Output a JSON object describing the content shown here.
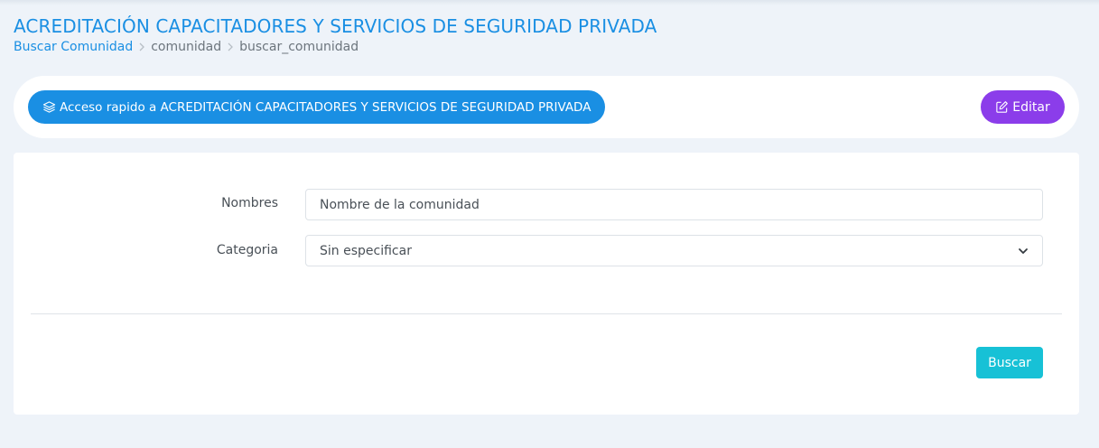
{
  "page": {
    "title": "ACREDITACIÓN CAPACITADORES Y SERVICIOS DE SEGURIDAD PRIVADA"
  },
  "breadcrumb": {
    "items": [
      "Buscar Comunidad",
      "comunidad",
      "buscar_comunidad"
    ]
  },
  "quickbar": {
    "quick_access_label": "Acceso rapido a ACREDITACIÓN CAPACITADORES Y SERVICIOS DE SEGURIDAD PRIVADA",
    "quick_access_icon": "layers-icon",
    "edit_label": "Editar",
    "edit_icon": "edit-icon"
  },
  "form": {
    "nombres_label": "Nombres",
    "nombres_placeholder": "Nombre de la comunidad",
    "nombres_value": "",
    "categoria_label": "Categoria",
    "categoria_selected": "Sin especificar",
    "search_label": "Buscar"
  },
  "colors": {
    "primary": "#1a8fe3",
    "edit": "#8b3dea",
    "search": "#17c1d6",
    "background": "#eef3f9"
  }
}
